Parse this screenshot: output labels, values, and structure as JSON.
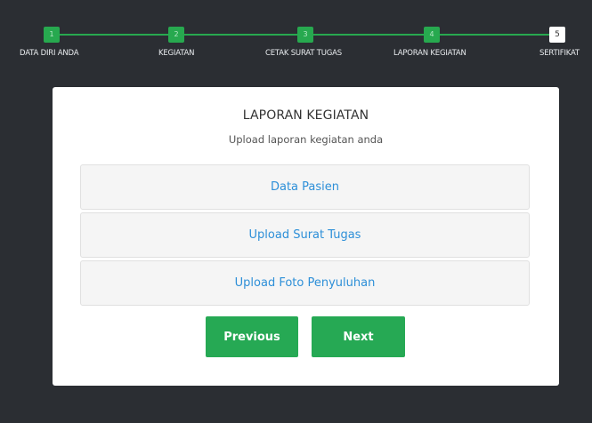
{
  "wizard": {
    "steps": [
      {
        "number": "1",
        "label": "DATA DIRI ANDA",
        "status": "done"
      },
      {
        "number": "2",
        "label": "KEGIATAN",
        "status": "done"
      },
      {
        "number": "3",
        "label": "CETAK SURAT TUGAS",
        "status": "done"
      },
      {
        "number": "4",
        "label": "LAPORAN KEGIATAN",
        "status": "done"
      },
      {
        "number": "5",
        "label": "SERTIFIKAT",
        "status": "current"
      }
    ]
  },
  "card": {
    "title": "LAPORAN KEGIATAN",
    "subtitle": "Upload laporan kegiatan anda",
    "items": [
      {
        "label": "Data Pasien"
      },
      {
        "label": "Upload Surat Tugas"
      },
      {
        "label": "Upload Foto Penyuluhan"
      }
    ],
    "previous_label": "Previous",
    "next_label": "Next"
  },
  "colors": {
    "background": "#2b2e33",
    "accent": "#27a94f",
    "link": "#2d8fd8"
  }
}
